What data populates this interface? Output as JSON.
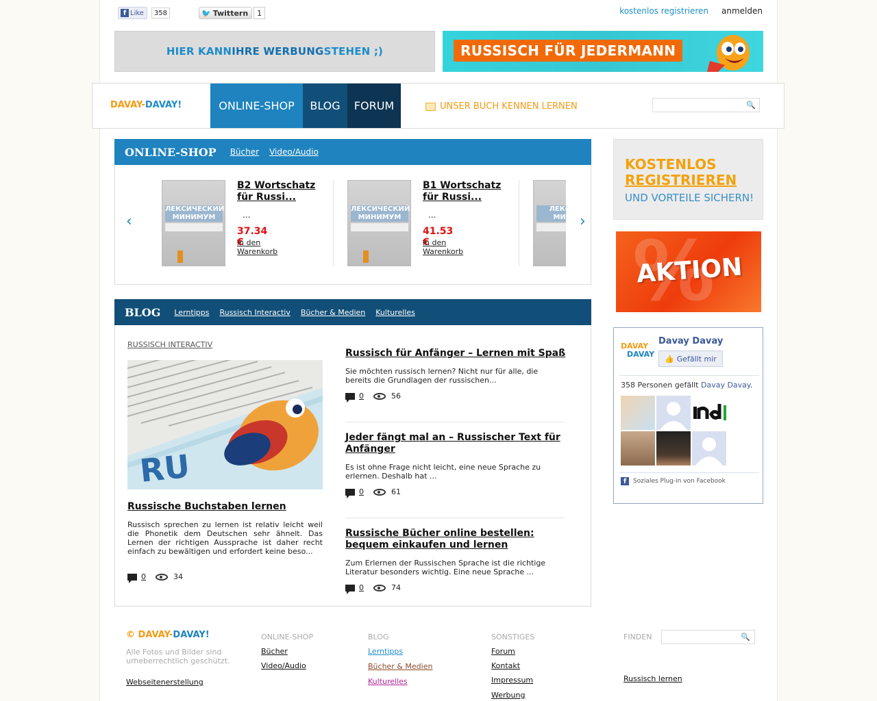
{
  "social": {
    "fb_like_label": "Like",
    "fb_like_count": "358",
    "twitter_label": "Twittern",
    "twitter_count": "1"
  },
  "toplinks": {
    "register": "kostenlos registrieren",
    "login": "anmelden"
  },
  "banners": {
    "left_part1": "HIER KANN ",
    "left_part2": "IHRE WERBUNG",
    "left_part3": " STEHEN  ;)",
    "right_text": "RUSSISCH FÜR JEDERMANN"
  },
  "nav": {
    "logo_part1": "DAVAY-",
    "logo_part2": "DAVAY!",
    "items": [
      "ONLINE-SHOP",
      "BLOG",
      "FORUM"
    ],
    "book_promo": "UNSER BUCH KENNEN LERNEN",
    "search_placeholder": ""
  },
  "shop": {
    "title": "ONLINE-SHOP",
    "links": [
      "Bücher",
      "Video/Audio"
    ],
    "products": [
      {
        "title": "B2 Wortschatz für Russi...",
        "dots": "...",
        "price": "37.34 €",
        "cart": "in den Warenkorb",
        "cover": "ЛЕКСИЧЕСКИЙ МИНИМУМ"
      },
      {
        "title": "B1 Wortschatz für Russi...",
        "dots": "...",
        "price": "41.53 €",
        "cart": "in den Warenkorb",
        "cover": "ЛЕКСИЧЕСКИЙ МИНИМУМ"
      }
    ],
    "partial_cover": "ЛЕКСИЧ МИНИ"
  },
  "blog": {
    "title": "BLOG",
    "links": [
      "Lerntipps",
      "Russisch Interactiv",
      "Bücher & Medien",
      "Kulturelles"
    ],
    "featured": {
      "category": "RUSSISCH INTERACTIV",
      "title": "Russische Buchstaben lernen",
      "text": "Russisch sprechen zu lernen ist relativ leicht weil die Phonetik dem Deutschen sehr ähnelt. Das Lernen der richtigen Aussprache ist daher recht einfach zu bewältigen und erfordert keine beso...",
      "comments": "0",
      "views": "34",
      "image_text": "RU"
    },
    "articles": [
      {
        "title": "Russisch für Anfänger – Lernen mit Spaß",
        "text": "Sie möchten russisch lernen? Nicht nur für alle, die bereits die Grundlagen der russischen...",
        "comments": "0",
        "views": "56"
      },
      {
        "title": "Jeder fängt mal an – Russischer Text für Anfänger",
        "text": "Es ist ohne Frage nicht leicht, eine neue Sprache zu erlernen. Deshalb hat ...",
        "comments": "0",
        "views": "61"
      },
      {
        "title": "Russische Bücher online bestellen: bequem einkaufen und lernen",
        "text": "Zum Erlernen der Russischen Sprache ist die richtige Literatur besonders wichtig. Eine neue Sprache ...",
        "comments": "0",
        "views": "74"
      }
    ]
  },
  "sidebar": {
    "promo_line1": "KOSTENLOS",
    "promo_line2": "REGISTRIEREN",
    "promo_line3": "UND VORTEILE SICHERN!",
    "aktion": "AKTION",
    "aktion_bg": "%",
    "facebook": {
      "avatar_top": "DAVAY",
      "avatar_bottom": "DAVAY",
      "page_name": "Davay Davay",
      "like_button": "Gefällt mir",
      "count_text": "358 Personen gefällt ",
      "count_link": "Davay Davay",
      "count_suffix": ".",
      "plugin_text": "Soziales Plug-in von Facebook"
    }
  },
  "footer": {
    "logo_prefix": "© ",
    "logo_part1": "DAVAY-",
    "logo_part2": "DAVAY!",
    "copyright": "Alle Fotos und Bilder sind urheberrechtlich geschützt.",
    "webdesign_link": "Webseitenerstellung",
    "col1_head": "ONLINE-SHOP",
    "col1_links": [
      "Bücher",
      "Video/Audio"
    ],
    "col2_head": "BLOG",
    "col2_links": [
      "Lerntipps",
      "Bücher & Medien",
      "Kulturelles"
    ],
    "col3_head": "SONSTIGES",
    "col3_links": [
      "Forum",
      "Kontakt",
      "Impressum",
      "Werbung"
    ],
    "find_label": "FINDEN",
    "bottom_link": "Russisch lernen"
  },
  "colors": {
    "shop_blue": "#1e83bf",
    "blog_navy": "#114f78",
    "forum_dark": "#0d3452",
    "accent_orange": "#f39a12",
    "price_red": "#dd1111",
    "lerntipps_color": "#1e8ccb",
    "buecher_color": "#8b4a2b",
    "kulturelles_color": "#b0249a"
  }
}
